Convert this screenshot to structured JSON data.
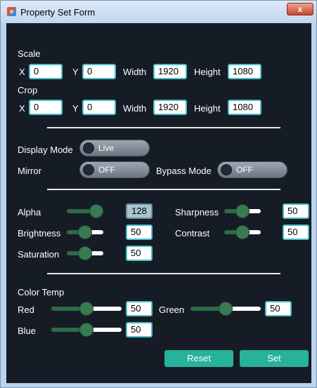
{
  "window": {
    "title": "Property Set Form",
    "close_label": "x"
  },
  "scale": {
    "heading": "Scale",
    "x_label": "X",
    "x": "0",
    "y_label": "Y",
    "y": "0",
    "width_label": "Width",
    "width": "1920",
    "height_label": "Height",
    "height": "1080"
  },
  "crop": {
    "heading": "Crop",
    "x_label": "X",
    "x": "0",
    "y_label": "Y",
    "y": "0",
    "width_label": "Width",
    "width": "1920",
    "height_label": "Height",
    "height": "1080"
  },
  "display": {
    "display_mode_label": "Display Mode",
    "display_mode_value": "Live",
    "mirror_label": "Mirror",
    "mirror_value": "OFF",
    "bypass_label": "Bypass Mode",
    "bypass_value": "OFF"
  },
  "image": {
    "alpha_label": "Alpha",
    "alpha": "128",
    "alpha_level": 1.0,
    "sharpness_label": "Sharpness",
    "sharpness": "50",
    "sharpness_level": 0.5,
    "brightness_label": "Brightness",
    "brightness": "50",
    "brightness_level": 0.5,
    "contrast_label": "Contrast",
    "contrast": "50",
    "contrast_level": 0.5,
    "saturation_label": "Saturation",
    "saturation": "50",
    "saturation_level": 0.5
  },
  "color_temp": {
    "heading": "Color Temp",
    "red_label": "Red",
    "red": "50",
    "red_level": 0.5,
    "green_label": "Green",
    "green": "50",
    "green_level": 0.5,
    "blue_label": "Blue",
    "blue": "50",
    "blue_level": 0.5
  },
  "buttons": {
    "reset_label": "Reset",
    "set_label": "Set"
  },
  "colors": {
    "background": "#151c25",
    "accent": "#27b29a",
    "input_border": "#4ac0c9",
    "slider_thumb": "#3a7a52"
  }
}
